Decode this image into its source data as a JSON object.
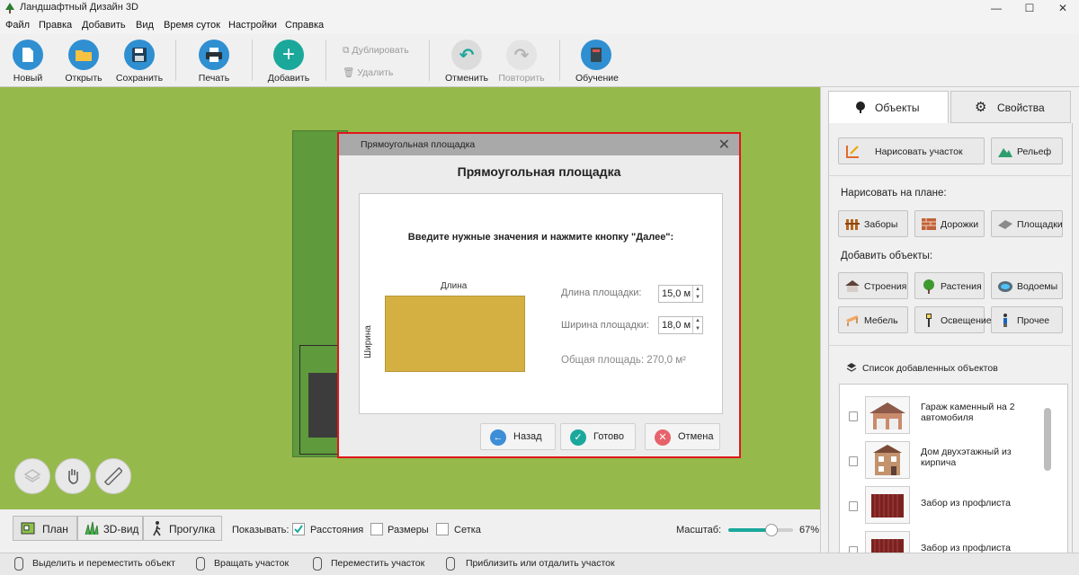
{
  "window": {
    "title": "Ландшафтный Дизайн 3D",
    "min_icon": "minimize-icon",
    "max_icon": "maximize-icon",
    "close_icon": "close-icon"
  },
  "menu": [
    "Файл",
    "Правка",
    "Добавить",
    "Вид",
    "Время суток",
    "Настройки",
    "Справка"
  ],
  "toolbar": {
    "new": "Новый",
    "open": "Открыть",
    "save": "Сохранить",
    "print": "Печать",
    "add": "Добавить",
    "duplicate": "Дублировать",
    "delete": "Удалить",
    "undo": "Отменить",
    "redo": "Повторить",
    "learn": "Обучение"
  },
  "dialog": {
    "window_title": "Прямоугольная площадка",
    "heading": "Прямоугольная площадка",
    "prompt": "Введите нужные значения и нажмите кнопку \"Далее\":",
    "length_caption": "Длина",
    "width_caption": "Ширина",
    "length_label": "Длина площадки:",
    "length_value": "15,0 м",
    "width_label": "Ширина площадки:",
    "width_value": "18,0 м",
    "area_text": "Общая площадь:  270,0 м²",
    "back": "Назад",
    "done": "Готово",
    "cancel": "Отмена"
  },
  "panel": {
    "tab_objects": "Объекты",
    "tab_properties": "Свойства",
    "draw_plot": "Нарисовать участок",
    "relief": "Рельеф",
    "draw_on_plan": "Нарисовать на плане:",
    "fences": "Заборы",
    "paths": "Дорожки",
    "platforms": "Площадки",
    "add_objects": "Добавить объекты:",
    "buildings": "Строения",
    "plants": "Растения",
    "ponds": "Водоемы",
    "furniture": "Мебель",
    "lighting": "Освещение",
    "other": "Прочее",
    "list_title": "Список добавленных объектов",
    "list_items": [
      "Гараж каменный на 2 автомобиля",
      "Дом двухэтажный из кирпича",
      "Забор из профлиста",
      "Забор из профлиста"
    ]
  },
  "bottom": {
    "plan": "План",
    "view3d": "3D-вид",
    "walk": "Прогулка",
    "show": "Показывать:",
    "distances": "Расстояния",
    "distances_checked": true,
    "sizes": "Размеры",
    "grid": "Сетка",
    "scale_label": "Масштаб:",
    "scale_value": "67%",
    "scale_fraction": 0.67
  },
  "status": {
    "select": "Выделить и переместить объект",
    "rotate": "Вращать участок",
    "move": "Переместить участок",
    "zoom": "Приблизить или отдалить участок"
  },
  "colors": {
    "accent": "#1aa89b",
    "canvas": "#96b94c",
    "highlight": "#e0161c",
    "plot": "#d4b043"
  }
}
